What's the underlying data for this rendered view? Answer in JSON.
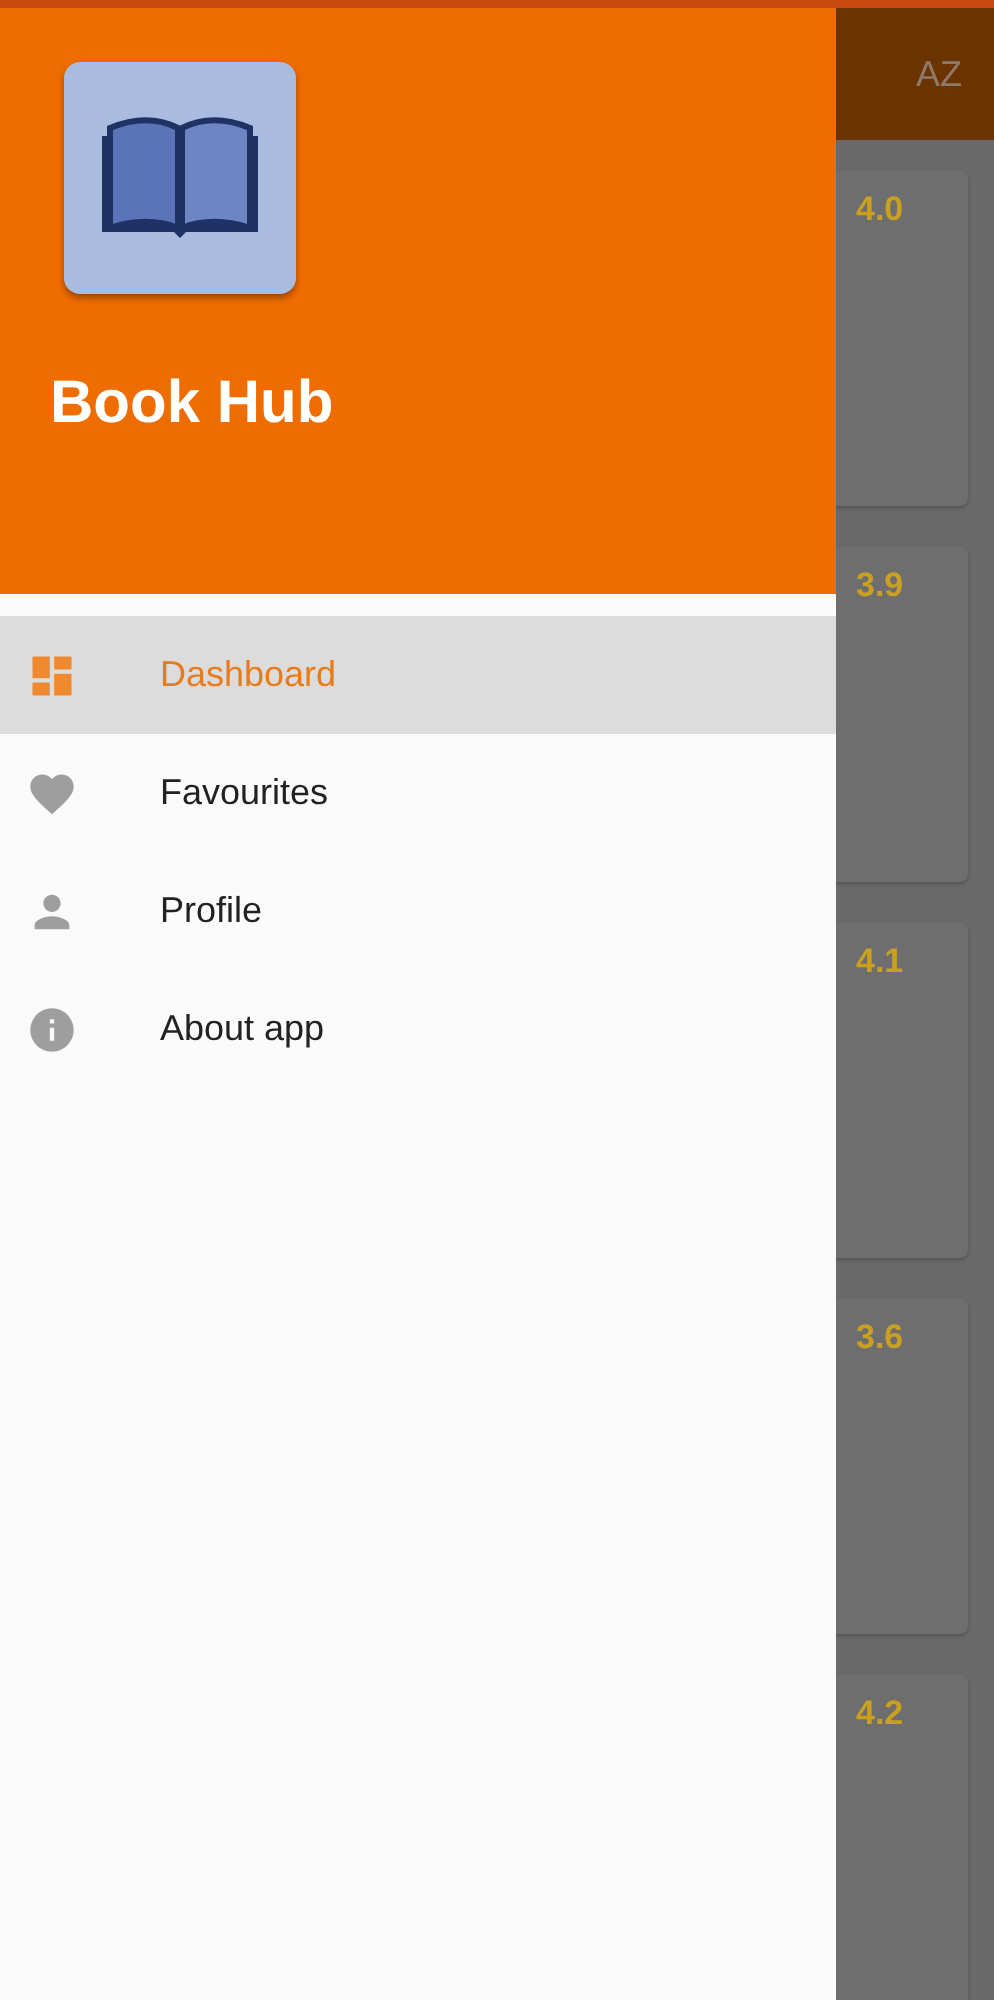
{
  "drawer": {
    "app_name": "Book Hub",
    "menu": [
      {
        "label": "Dashboard",
        "selected": true
      },
      {
        "label": "Favourites",
        "selected": false
      },
      {
        "label": "Profile",
        "selected": false
      },
      {
        "label": "About app",
        "selected": false
      }
    ]
  },
  "background": {
    "toolbar": {
      "sort_label": "AZ"
    },
    "book_ratings": [
      "4.0",
      "3.9",
      "4.1",
      "3.6",
      "4.2"
    ]
  }
}
